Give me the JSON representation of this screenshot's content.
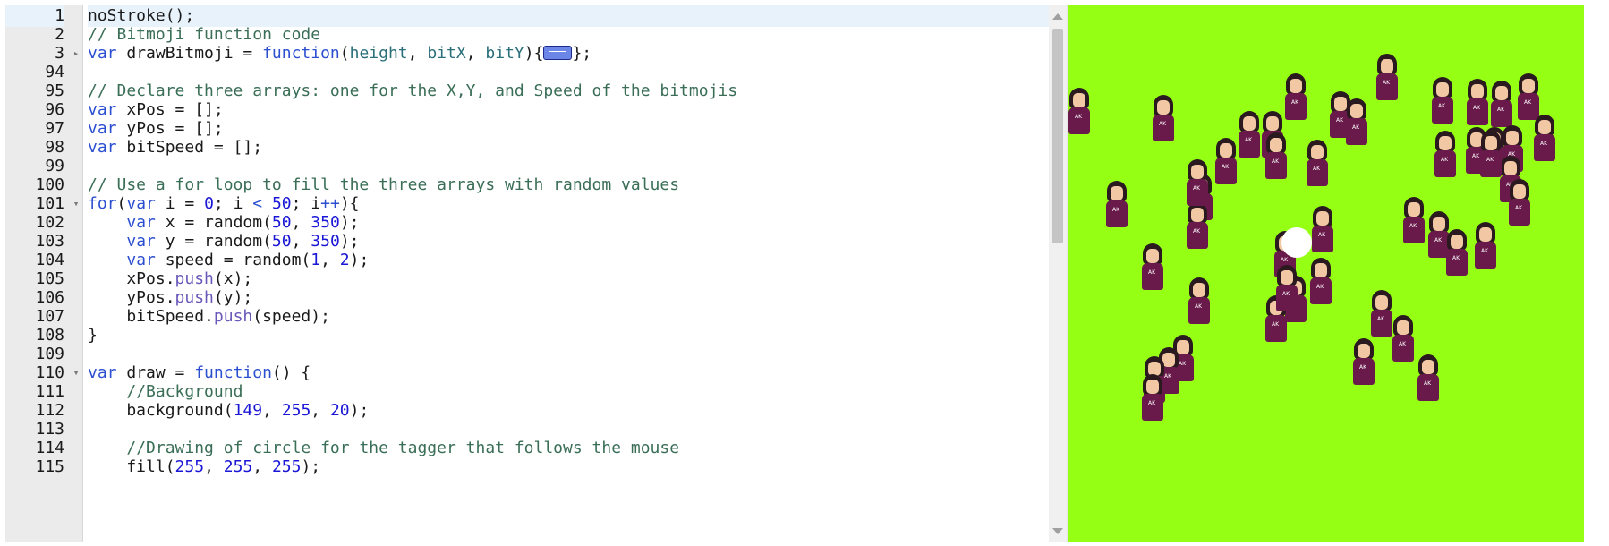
{
  "editor": {
    "lines": [
      {
        "n": "1",
        "fold": "",
        "tokens": [
          {
            "t": "noStroke();",
            "c": "plain"
          }
        ],
        "active": true
      },
      {
        "n": "2",
        "fold": "",
        "tokens": [
          {
            "t": "// Bitmoji function code",
            "c": "com"
          }
        ]
      },
      {
        "n": "3",
        "fold": "▸",
        "tokens": [
          {
            "t": "var",
            "c": "kw"
          },
          {
            "t": " drawBitmoji = ",
            "c": "plain"
          },
          {
            "t": "function",
            "c": "kw"
          },
          {
            "t": "(",
            "c": "plain"
          },
          {
            "t": "height",
            "c": "param"
          },
          {
            "t": ", ",
            "c": "plain"
          },
          {
            "t": "bitX",
            "c": "param"
          },
          {
            "t": ", ",
            "c": "plain"
          },
          {
            "t": "bitY",
            "c": "param"
          },
          {
            "t": "){",
            "c": "plain"
          },
          {
            "t": "",
            "c": "foldmarker"
          },
          {
            "t": "};",
            "c": "plain"
          }
        ]
      },
      {
        "n": "94",
        "fold": "",
        "tokens": []
      },
      {
        "n": "95",
        "fold": "",
        "tokens": [
          {
            "t": "// Declare three arrays: one for the X,Y, and Speed of the bitmojis",
            "c": "com"
          }
        ]
      },
      {
        "n": "96",
        "fold": "",
        "tokens": [
          {
            "t": "var",
            "c": "kw"
          },
          {
            "t": " xPos = [];",
            "c": "plain"
          }
        ]
      },
      {
        "n": "97",
        "fold": "",
        "tokens": [
          {
            "t": "var",
            "c": "kw"
          },
          {
            "t": " yPos = [];",
            "c": "plain"
          }
        ]
      },
      {
        "n": "98",
        "fold": "",
        "tokens": [
          {
            "t": "var",
            "c": "kw"
          },
          {
            "t": " bitSpeed = [];",
            "c": "plain"
          }
        ]
      },
      {
        "n": "99",
        "fold": "",
        "tokens": []
      },
      {
        "n": "100",
        "fold": "",
        "tokens": [
          {
            "t": "// Use a for loop to fill the three arrays with random values",
            "c": "com"
          }
        ]
      },
      {
        "n": "101",
        "fold": "▾",
        "tokens": [
          {
            "t": "for",
            "c": "kw"
          },
          {
            "t": "(",
            "c": "plain"
          },
          {
            "t": "var",
            "c": "kw"
          },
          {
            "t": " i = ",
            "c": "plain"
          },
          {
            "t": "0",
            "c": "num"
          },
          {
            "t": "; i ",
            "c": "plain"
          },
          {
            "t": "<",
            "c": "kw"
          },
          {
            "t": " ",
            "c": "plain"
          },
          {
            "t": "50",
            "c": "num"
          },
          {
            "t": "; i",
            "c": "plain"
          },
          {
            "t": "++",
            "c": "kw"
          },
          {
            "t": "){",
            "c": "plain"
          }
        ]
      },
      {
        "n": "102",
        "fold": "",
        "tokens": [
          {
            "t": "    ",
            "c": "plain"
          },
          {
            "t": "var",
            "c": "kw"
          },
          {
            "t": " x = random(",
            "c": "plain"
          },
          {
            "t": "50",
            "c": "num"
          },
          {
            "t": ", ",
            "c": "plain"
          },
          {
            "t": "350",
            "c": "num"
          },
          {
            "t": ");",
            "c": "plain"
          }
        ]
      },
      {
        "n": "103",
        "fold": "",
        "tokens": [
          {
            "t": "    ",
            "c": "plain"
          },
          {
            "t": "var",
            "c": "kw"
          },
          {
            "t": " y = random(",
            "c": "plain"
          },
          {
            "t": "50",
            "c": "num"
          },
          {
            "t": ", ",
            "c": "plain"
          },
          {
            "t": "350",
            "c": "num"
          },
          {
            "t": ");",
            "c": "plain"
          }
        ]
      },
      {
        "n": "104",
        "fold": "",
        "tokens": [
          {
            "t": "    ",
            "c": "plain"
          },
          {
            "t": "var",
            "c": "kw"
          },
          {
            "t": " speed = random(",
            "c": "plain"
          },
          {
            "t": "1",
            "c": "num"
          },
          {
            "t": ", ",
            "c": "plain"
          },
          {
            "t": "2",
            "c": "num"
          },
          {
            "t": ");",
            "c": "plain"
          }
        ]
      },
      {
        "n": "105",
        "fold": "",
        "tokens": [
          {
            "t": "    xPos.",
            "c": "plain"
          },
          {
            "t": "push",
            "c": "prop"
          },
          {
            "t": "(x);",
            "c": "plain"
          }
        ]
      },
      {
        "n": "106",
        "fold": "",
        "tokens": [
          {
            "t": "    yPos.",
            "c": "plain"
          },
          {
            "t": "push",
            "c": "prop"
          },
          {
            "t": "(y);",
            "c": "plain"
          }
        ]
      },
      {
        "n": "107",
        "fold": "",
        "tokens": [
          {
            "t": "    bitSpeed.",
            "c": "plain"
          },
          {
            "t": "push",
            "c": "prop"
          },
          {
            "t": "(speed);",
            "c": "plain"
          }
        ]
      },
      {
        "n": "108",
        "fold": "",
        "tokens": [
          {
            "t": "}",
            "c": "plain"
          }
        ]
      },
      {
        "n": "109",
        "fold": "",
        "tokens": []
      },
      {
        "n": "110",
        "fold": "▾",
        "tokens": [
          {
            "t": "var",
            "c": "kw"
          },
          {
            "t": " draw = ",
            "c": "plain"
          },
          {
            "t": "function",
            "c": "kw"
          },
          {
            "t": "() {",
            "c": "plain"
          }
        ]
      },
      {
        "n": "111",
        "fold": "",
        "tokens": [
          {
            "t": "    ",
            "c": "plain"
          },
          {
            "t": "//Background",
            "c": "com"
          }
        ]
      },
      {
        "n": "112",
        "fold": "",
        "tokens": [
          {
            "t": "    background(",
            "c": "plain"
          },
          {
            "t": "149",
            "c": "num"
          },
          {
            "t": ", ",
            "c": "plain"
          },
          {
            "t": "255",
            "c": "num"
          },
          {
            "t": ", ",
            "c": "plain"
          },
          {
            "t": "20",
            "c": "num"
          },
          {
            "t": ");",
            "c": "plain"
          }
        ]
      },
      {
        "n": "113",
        "fold": "",
        "tokens": []
      },
      {
        "n": "114",
        "fold": "",
        "tokens": [
          {
            "t": "    ",
            "c": "plain"
          },
          {
            "t": "//Drawing of circle for the tagger that follows the mouse",
            "c": "com"
          }
        ]
      },
      {
        "n": "115",
        "fold": "",
        "tokens": [
          {
            "t": "    fill(",
            "c": "plain"
          },
          {
            "t": "255",
            "c": "num"
          },
          {
            "t": ", ",
            "c": "plain"
          },
          {
            "t": "255",
            "c": "num"
          },
          {
            "t": ", ",
            "c": "plain"
          },
          {
            "t": "255",
            "c": "num"
          },
          {
            "t": ");",
            "c": "plain"
          }
        ]
      }
    ]
  },
  "colors": {
    "canvas_background": "#95ff14",
    "bitmoji_shirt": "#6a1a4a",
    "tagger": "#ffffff"
  },
  "icons": {
    "fold_collapsed": "triangle-right-icon",
    "fold_expanded": "triangle-down-icon",
    "fold_marker": "fold-marker-icon"
  }
}
